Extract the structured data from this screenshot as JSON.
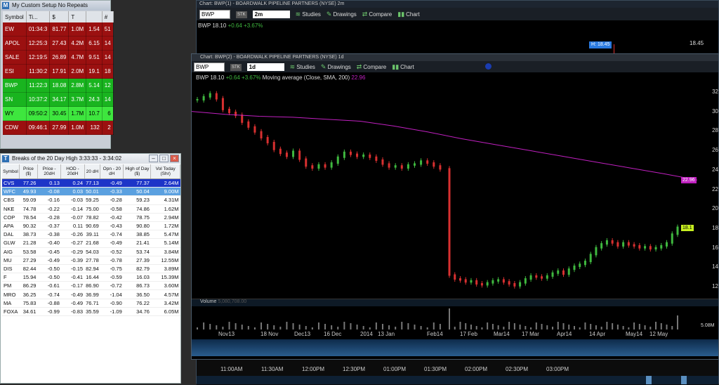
{
  "watchlist": {
    "title": "My Custom Setup No Repeats",
    "columns": [
      "Symbol",
      "Ti...",
      "$",
      "T",
      "",
      "#"
    ],
    "rows": [
      {
        "symbol": "EW",
        "time": "01:34:3",
        "price": "81.77",
        "vol": "1.0M",
        "c4": "1.54",
        "c5": "51",
        "color": "#9b1010"
      },
      {
        "symbol": "APOL",
        "time": "12:25:3",
        "price": "27.43",
        "vol": "4.2M",
        "c4": "6.15",
        "c5": "14",
        "color": "#9b1010"
      },
      {
        "symbol": "SALE",
        "time": "12:19:5",
        "price": "26.89",
        "vol": "4.7M",
        "c4": "9.51",
        "c5": "14",
        "color": "#9b1010"
      },
      {
        "symbol": "ESI",
        "time": "11:30:2",
        "price": "17.91",
        "vol": "2.0M",
        "c4": "19.1",
        "c5": "18",
        "color": "#9b1010"
      },
      {
        "symbol": "BWP",
        "time": "11:22:3",
        "price": "18.08",
        "vol": "2.8M",
        "c4": "5.14",
        "c5": "12",
        "color": "#19b41f"
      },
      {
        "symbol": "SN",
        "time": "10:37:2",
        "price": "34.17",
        "vol": "3.7M",
        "c4": "24.3",
        "c5": "14",
        "color": "#19b41f"
      },
      {
        "symbol": "WY",
        "time": "09:50:2",
        "price": "30.45",
        "vol": "1.7M",
        "c4": "10.7",
        "c5": "6",
        "color": "#3ee63e"
      },
      {
        "symbol": "CDW",
        "time": "09:46:1",
        "price": "27.99",
        "vol": "1.0M",
        "c4": "132",
        "c5": "2",
        "color": "#9b1010"
      }
    ]
  },
  "scan": {
    "title": "Breaks of the 20 Day High  3:33:33 - 3:34:02",
    "columns": [
      "Symbol",
      "Price ($)",
      "Price - 20dH",
      "HOD - 20dH",
      "20 dH",
      "Opn - 20 dH",
      "High of Day ($)",
      "Vol Today (Shr)"
    ],
    "rows": [
      [
        "CVS",
        "77.26",
        "0.13",
        "0.24",
        "77.13",
        "-0.49",
        "77.37",
        "2.64M"
      ],
      [
        "WFC",
        "49.93",
        "-0.08",
        "0.03",
        "50.01",
        "-0.33",
        "50.04",
        "9.00M"
      ],
      [
        "CBS",
        "59.09",
        "-0.16",
        "-0.03",
        "59.25",
        "-0.28",
        "59.23",
        "4.31M"
      ],
      [
        "NKE",
        "74.78",
        "-0.22",
        "-0.14",
        "75.00",
        "-0.58",
        "74.86",
        "1.62M"
      ],
      [
        "COP",
        "78.54",
        "-0.28",
        "-0.07",
        "78.82",
        "-0.42",
        "78.75",
        "2.94M"
      ],
      [
        "APA",
        "90.32",
        "-0.37",
        "0.11",
        "90.69",
        "-0.43",
        "90.80",
        "1.72M"
      ],
      [
        "DAL",
        "38.73",
        "-0.38",
        "-0.26",
        "39.11",
        "-0.74",
        "38.85",
        "5.47M"
      ],
      [
        "GLW",
        "21.28",
        "-0.40",
        "-0.27",
        "21.68",
        "-0.49",
        "21.41",
        "5.14M"
      ],
      [
        "AIG",
        "53.58",
        "-0.45",
        "-0.29",
        "54.03",
        "-0.52",
        "53.74",
        "3.84M"
      ],
      [
        "MU",
        "27.29",
        "-0.49",
        "-0.39",
        "27.78",
        "-0.78",
        "27.39",
        "12.55M"
      ],
      [
        "DIS",
        "82.44",
        "-0.50",
        "-0.15",
        "82.94",
        "-0.75",
        "82.79",
        "3.89M"
      ],
      [
        "F",
        "15.94",
        "-0.50",
        "-0.41",
        "16.44",
        "-0.59",
        "16.03",
        "15.39M"
      ],
      [
        "PM",
        "86.29",
        "-0.61",
        "-0.17",
        "86.90",
        "-0.72",
        "86.73",
        "3.60M"
      ],
      [
        "MRO",
        "36.25",
        "-0.74",
        "-0.49",
        "36.99",
        "-1.04",
        "36.50",
        "4.57M"
      ],
      [
        "MA",
        "75.83",
        "-0.88",
        "-0.49",
        "76.71",
        "-0.90",
        "76.22",
        "3.42M"
      ],
      [
        "FOXA",
        "34.61",
        "-0.99",
        "-0.83",
        "35.59",
        "-1.09",
        "34.76",
        "6.05M"
      ]
    ]
  },
  "chart_back": {
    "title": "Chart: BWP(1) - BOARDWALK PIPELINE PARTNERS (NYSE) 2m",
    "symbol": "BWP",
    "type_badge": "STK",
    "period": "2m",
    "studies": "Studies",
    "drawings": "Drawings",
    "compare": "Compare",
    "chart": "Chart",
    "quote_sym": "BWP",
    "quote_price": "18.10",
    "quote_change": "+0.64  +3.67%",
    "price_label": "18.45",
    "hl_label": "H: 18.45",
    "time_labels": [
      "11:00AM",
      "11:30AM",
      "12:00PM",
      "12:30PM",
      "01:00PM",
      "01:30PM",
      "02:00PM",
      "02:30PM",
      "03:00PM"
    ]
  },
  "chart_front": {
    "title": "Chart: BWP(2) - BOARDWALK PIPELINE PARTNERS (NYSE) 1d",
    "symbol": "BWP",
    "type_badge": "STK",
    "period": "1d",
    "studies": "Studies",
    "drawings": "Drawings",
    "compare": "Compare",
    "chart": "Chart",
    "quote_sym": "BWP",
    "quote_price": "18.10",
    "quote_change": "+0.64  +3.67%",
    "study_label": "Moving average (Close, SMA, 200)",
    "study_value": "22.96",
    "ma_label": "22.96",
    "last_label": "18.1",
    "volume_label": "Volume",
    "volume_value": "5,080,708.00",
    "volume_axis": "5.08M",
    "colors": {
      "up": "#3fb83f",
      "down": "#d83030",
      "ma": "#c020c0",
      "last": "#c8f020"
    }
  },
  "chart_data": {
    "type": "line",
    "title": "",
    "ylim": [
      11,
      33
    ],
    "yticks": [
      12,
      14,
      16,
      18,
      20,
      22,
      24,
      26,
      28,
      30,
      32
    ],
    "x_labels": [
      "Nov13",
      "18 Nov",
      "Dec13",
      "16 Dec",
      "2014",
      "13 Jan",
      "Feb14",
      "17 Feb",
      "Mar14",
      "17 Mar",
      "Apr14",
      "14 Apr",
      "May14",
      "12 May"
    ],
    "series": [
      {
        "values": [
          31.2,
          31.5,
          31.8,
          31.3,
          30.2,
          29.9,
          29.6,
          28.9,
          28.4,
          27.9,
          27.3,
          26.8,
          26.1,
          25.7,
          25.4,
          25.9,
          25.1,
          24.4,
          24.2,
          24.5,
          24.3,
          24.7,
          25.3,
          25.8,
          25.6,
          25.4,
          25.5,
          25.3,
          25.0,
          24.6,
          24.3,
          24.4,
          24.2,
          24.5,
          24.6,
          24.9,
          24.7,
          24.4,
          24.1,
          13.2,
          12.8,
          12.7,
          12.5,
          12.6,
          12.3,
          12.2,
          12.4,
          12.6,
          12.7,
          12.5,
          12.3,
          12.1,
          12.4,
          12.8,
          13.1,
          13.0,
          12.9,
          13.1,
          13.4,
          13.6,
          13.3,
          13.8,
          14.1,
          14.3,
          14.6,
          15.3,
          16.0,
          16.4,
          16.7,
          16.5,
          16.2,
          16.5,
          16.3,
          16.2,
          16.0,
          16.1,
          15.9,
          16.0,
          16.2,
          16.5,
          17.4,
          18.1
        ]
      },
      {
        "values": [
          30.0,
          29.7,
          29.5,
          29.4,
          29.2,
          29.0,
          28.5,
          27.9,
          27.2,
          26.6,
          26.0,
          25.4,
          24.8,
          24.2,
          23.6,
          22.96
        ]
      }
    ]
  }
}
